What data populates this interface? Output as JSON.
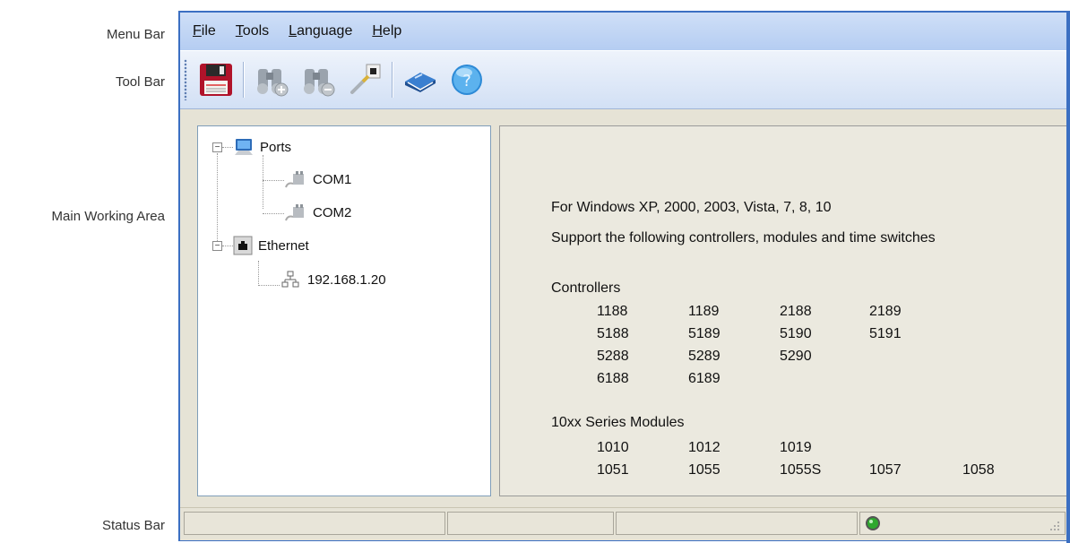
{
  "annotations": {
    "menu_bar": "Menu Bar",
    "tool_bar": "Tool Bar",
    "main_working_area": "Main Working Area",
    "status_bar": "Status Bar"
  },
  "menu": {
    "file_key": "F",
    "file_rest": "ile",
    "tools_key": "T",
    "tools_rest": "ools",
    "language_key": "L",
    "language_rest": "anguage",
    "help_key": "H",
    "help_rest": "elp"
  },
  "toolbar": {
    "icons": [
      "save-icon",
      "binoculars-add-icon",
      "binoculars-remove-icon",
      "connect-plug-icon",
      "book-icon",
      "help-icon"
    ]
  },
  "tree": {
    "ports_label": "Ports",
    "com1_label": "COM1",
    "com2_label": "COM2",
    "ethernet_label": "Ethernet",
    "ip_label": "192.168.1.20"
  },
  "info": {
    "line1": "For Windows XP, 2000, 2003, Vista, 7, 8, 10",
    "line2": "Support the following controllers, modules and time switches",
    "controllers_heading": "Controllers",
    "controllers_rows": [
      [
        "1188",
        "1189",
        "2188",
        "2189"
      ],
      [
        "5188",
        "5189",
        "5190",
        "5191"
      ],
      [
        "5288",
        "5289",
        "5290"
      ],
      [
        "6188",
        "6189"
      ]
    ],
    "modules_heading": "10xx Series Modules",
    "modules_rows": [
      [
        "1010",
        "1012",
        "1019"
      ],
      [
        "1051",
        "1055",
        "1055S",
        "1057",
        "1058"
      ]
    ]
  },
  "status": {
    "indicator_color": "#2ea82e"
  }
}
